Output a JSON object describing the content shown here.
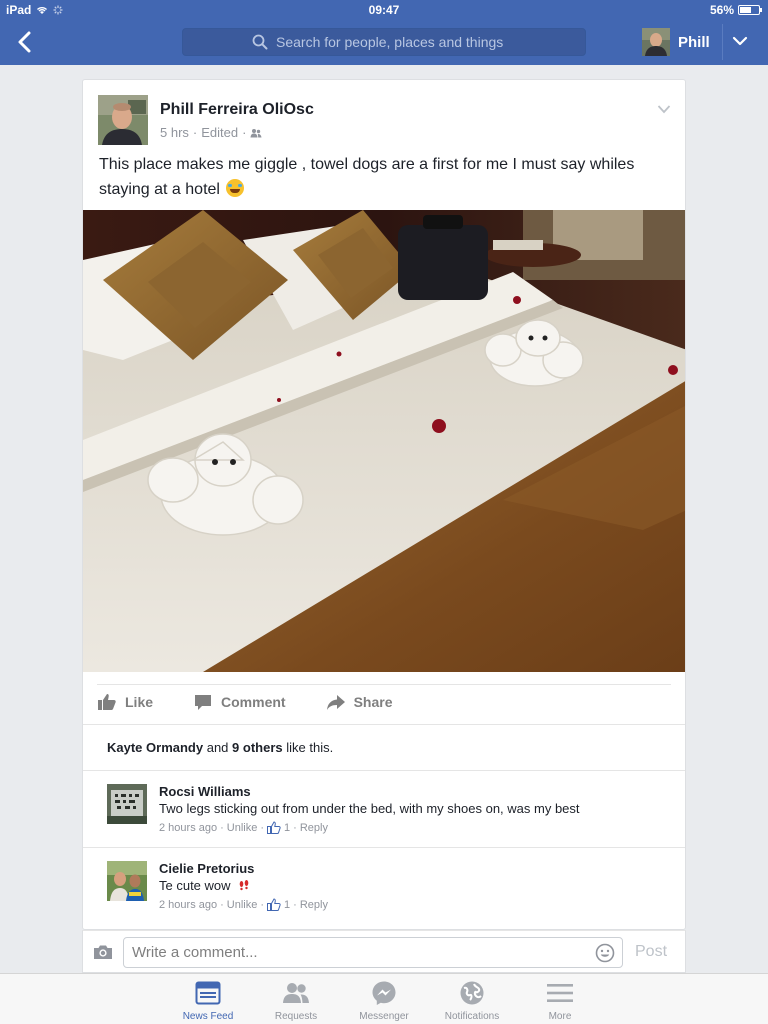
{
  "status_bar": {
    "device": "iPad",
    "time": "09:47",
    "battery": "56%"
  },
  "topbar": {
    "search_placeholder": "Search for people, places and things",
    "user_name": "Phill"
  },
  "post": {
    "author": "Phill Ferreira OliOsc",
    "time": "5 hrs",
    "edited": "Edited",
    "text": "This place makes me giggle , towel dogs are a first for me I must say whiles staying at a hotel",
    "actions": {
      "like": "Like",
      "comment": "Comment",
      "share": "Share"
    },
    "likes": {
      "name": "Kayte Ormandy",
      "and": "and",
      "others": "9 others",
      "suffix": "like this."
    },
    "comments": [
      {
        "name": "Rocsi Williams",
        "text": "Two legs sticking out from under the bed, with my shoes on, was my best",
        "time": "2 hours ago",
        "unlike": "Unlike",
        "likes": "1",
        "reply": "Reply"
      },
      {
        "name": "Cielie Pretorius",
        "text": "Te cute wow",
        "time": "2 hours ago",
        "unlike": "Unlike",
        "likes": "1",
        "reply": "Reply"
      }
    ]
  },
  "composer": {
    "placeholder": "Write a comment...",
    "post_label": "Post"
  },
  "tabs": [
    {
      "label": "News Feed",
      "icon": "news-feed-icon",
      "active": true
    },
    {
      "label": "Requests",
      "icon": "requests-icon",
      "active": false
    },
    {
      "label": "Messenger",
      "icon": "messenger-icon",
      "active": false
    },
    {
      "label": "Notifications",
      "icon": "notifications-icon",
      "active": false
    },
    {
      "label": "More",
      "icon": "more-icon",
      "active": false
    }
  ],
  "colors": {
    "brand": "#4267b2",
    "background": "#e9ebee",
    "muted": "#90949c",
    "link": "#4267b2"
  }
}
